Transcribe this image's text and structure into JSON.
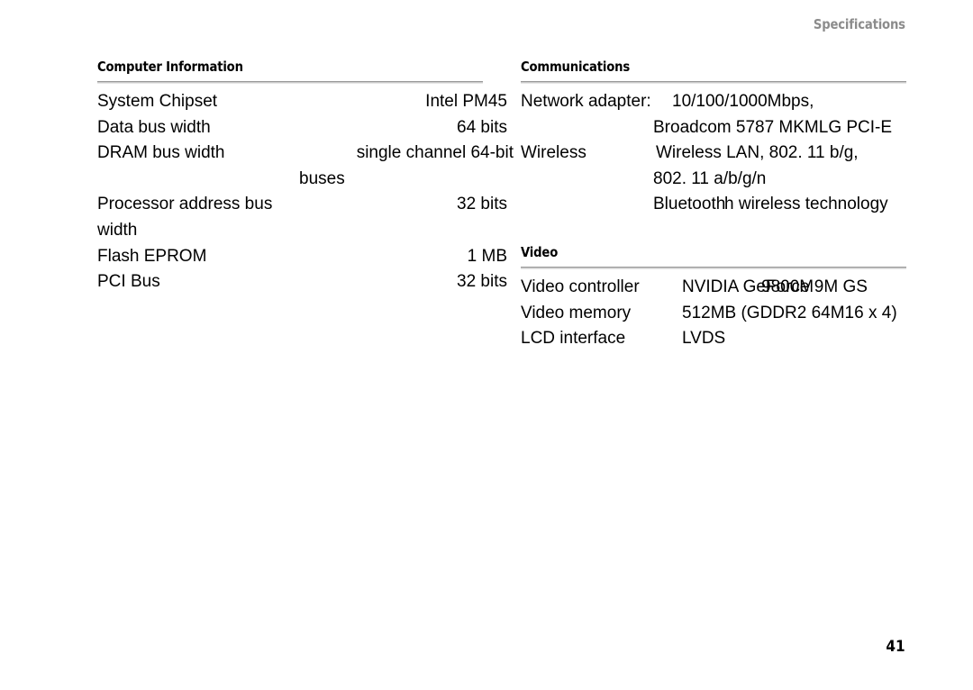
{
  "header": {
    "running_head": "Specifications"
  },
  "folio": {
    "page_number": "41"
  },
  "colors": {
    "heading_text": "#000000",
    "running_head_text": "#8c8c8c",
    "rule": "#9a9a9a",
    "body_text": "#000000",
    "page_background": "#ffffff"
  },
  "left_column": {
    "sections": [
      {
        "heading": "Computer Information",
        "rows": [
          {
            "label": "System Chipset",
            "value": "Intel PM45",
            "continuation": ""
          },
          {
            "label": "Data bus width",
            "value": "64 bits",
            "continuation": ""
          },
          {
            "label": "DRAM bus width",
            "value": "single channel 64-bit",
            "continuation": "buses"
          },
          {
            "label": "Processor address bus",
            "value": "32 bits",
            "continuation": "width",
            "continuation_align": "left"
          },
          {
            "label": "Flash EPROM",
            "value": "1 MB",
            "continuation": ""
          },
          {
            "label": "PCI Bus",
            "value": "32 bits",
            "continuation": ""
          }
        ]
      }
    ]
  },
  "right_column": {
    "sections": [
      {
        "heading": "Communications",
        "rows": [
          {
            "label": "Network adapter:",
            "value": "10/100/1000Mbps,",
            "continuations": [
              "Broadcom 5787 MKMLG PCI-E"
            ]
          },
          {
            "label": "Wireless",
            "value": "Wireless LAN, 802. 11 b/g,",
            "continuations": [
              "802. 11 a/b/g/n"
            ],
            "overlap_continuation": {
              "base": "Bluetooth",
              "overlay": "h wireless technology"
            }
          }
        ]
      },
      {
        "heading": "Video",
        "rows": [
          {
            "label": "Video controller",
            "overlap_value": {
              "base": "NVIDIA GeForce 9M GS",
              "overlay": "9800M"
            }
          },
          {
            "label": "Video memory",
            "value": "512MB (GDDR2 64M16 x 4)"
          },
          {
            "label": "LCD interface",
            "value": "LVDS"
          }
        ]
      }
    ]
  }
}
